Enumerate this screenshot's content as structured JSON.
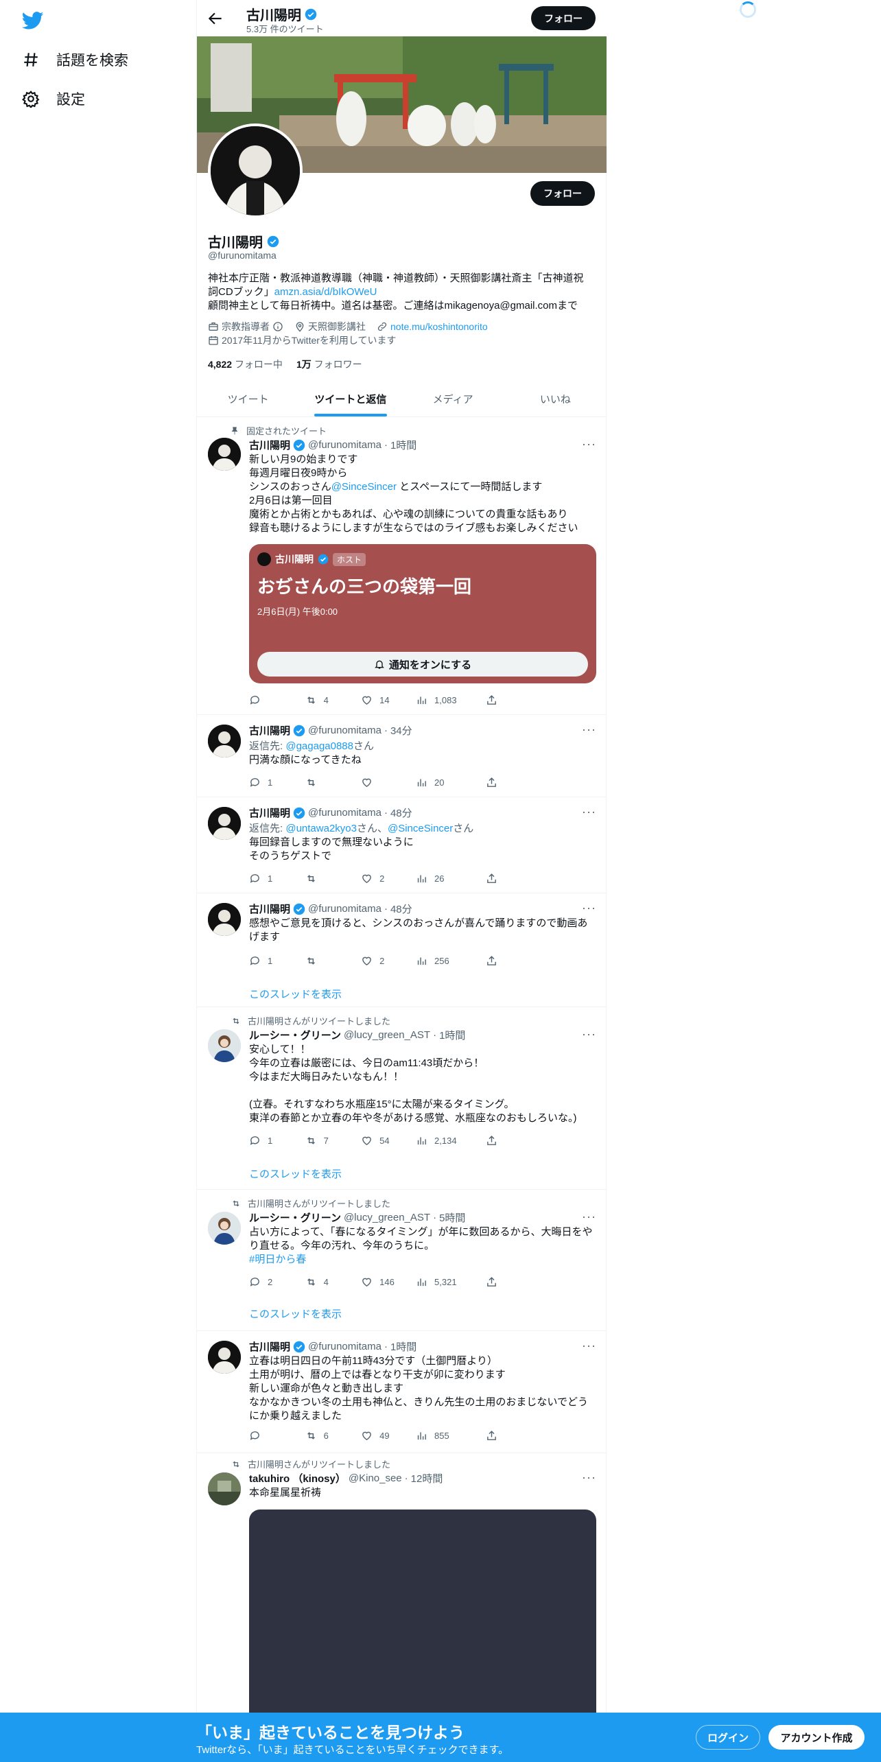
{
  "sidebar": {
    "items": [
      {
        "label": "話題を検索"
      },
      {
        "label": "設定"
      }
    ]
  },
  "header": {
    "name": "古川陽明",
    "tweet_count": "5.3万 件のツイート",
    "follow_label": "フォロー"
  },
  "profile": {
    "name": "古川陽明",
    "handle": "@furunomitama",
    "bio_line1": "神社本庁正階・教派神道教導職（神職・神道教師）・天照御影講社斎主「古神道祝詞CDブック」",
    "bio_link": "amzn.asia/d/bIkOWeU",
    "bio_line2": "顧問神主として毎日祈祷中。道名は基密。ご連絡はmikagenoya@gmail.comまで",
    "category": "宗教指導者",
    "location": "天照御影講社",
    "website": "note.mu/koshintonorito",
    "joined": "2017年11月からTwitterを利用しています",
    "following_count": "4,822",
    "following_label": "フォロー中",
    "followers_count": "1万",
    "followers_label": "フォロワー",
    "follow_label": "フォロー"
  },
  "tabs": [
    "ツイート",
    "ツイートと返信",
    "メディア",
    "いいね"
  ],
  "tweets": [
    {
      "context": "固定されたツイート",
      "name": "古川陽明",
      "handle": "@furunomitama",
      "time": "1時間",
      "body_a": "新しい月9の始まりです\n毎週月曜日夜9時から\nシンスのおっさん",
      "mention": "@SinceSincer",
      "body_b": " とスペースにて一時間話します\n2月6日は第一回目\n魔術とか占術とかもあれば、心や魂の訓練についての貴重な話もあり\n録音も聴けるようにしますが生ならではのライブ感もお楽しみください",
      "space": {
        "host": "古川陽明",
        "badge": "ホスト",
        "title": "おぢさんの三つの袋第一回",
        "date": "2月6日(月) 午後0:00",
        "button": "通知をオンにする"
      },
      "replies": "",
      "retweets": "4",
      "likes": "14",
      "views": "1,083"
    },
    {
      "name": "古川陽明",
      "handle": "@furunomitama",
      "time": "34分",
      "reply_prefix": "返信先: ",
      "reply_to": "@gagaga0888",
      "reply_suffix": "さん",
      "body": "円満な顔になってきたね",
      "replies": "1",
      "retweets": "",
      "likes": "",
      "views": "20"
    },
    {
      "name": "古川陽明",
      "handle": "@furunomitama",
      "time": "48分",
      "reply_prefix": "返信先: ",
      "reply_to": "@untawa2kyo3",
      "reply_mid": "さん、",
      "reply_to2": "@SinceSincer",
      "reply_suffix": "さん",
      "body": "毎回録音しますので無理ないように\nそのうちゲストで",
      "replies": "1",
      "retweets": "",
      "likes": "2",
      "views": "26"
    },
    {
      "name": "古川陽明",
      "handle": "@furunomitama",
      "time": "48分",
      "body": "感想やご意見を頂けると、シンスのおっさんが喜んで踊りますので動画あげます",
      "replies": "1",
      "retweets": "",
      "likes": "2",
      "views": "256",
      "thread": "このスレッドを表示"
    },
    {
      "context": "古川陽明さんがリツイートしました",
      "name": "ルーシー・グリーン",
      "handle": "@lucy_green_AST",
      "time": "1時間",
      "body": "安心して！！\n今年の立春は厳密には、今日のam11:43頃だから！\n今はまだ大晦日みたいなもん！！\n\n(立春。それすなわち水瓶座15°に太陽が来るタイミング。\n東洋の春節とか立春の年や冬があける感覚、水瓶座なのおもしろいな。)",
      "replies": "1",
      "retweets": "7",
      "likes": "54",
      "views": "2,134",
      "thread": "このスレッドを表示"
    },
    {
      "context": "古川陽明さんがリツイートしました",
      "name": "ルーシー・グリーン",
      "handle": "@lucy_green_AST",
      "time": "5時間",
      "body": "占い方によって、「春になるタイミング」が年に数回あるから、大晦日をやり直せる。今年の汚れ、今年のうちに。",
      "hashtag": "#明日から春",
      "replies": "2",
      "retweets": "4",
      "likes": "146",
      "views": "5,321",
      "thread": "このスレッドを表示"
    },
    {
      "name": "古川陽明",
      "handle": "@furunomitama",
      "time": "1時間",
      "body": "立春は明日四日の午前11時43分です（土御門暦より）\n土用が明け、暦の上では春となり干支が卯に変わります\n新しい運命が色々と動き出します\nなかなかきつい冬の土用も神仏と、きりん先生の土用のおまじないでどうにか乗り越えました",
      "replies": "",
      "retweets": "6",
      "likes": "49",
      "views": "855"
    },
    {
      "context": "古川陽明さんがリツイートしました",
      "name": "takuhiro （kinosy）",
      "handle": "@Kino_see",
      "time": "12時間",
      "body": "本命星属星祈祷"
    }
  ],
  "bottom": {
    "title": "「いま」起きていることを見つけよう",
    "subtitle": "Twitterなら、「いま」起きていることをいち早くチェックできます。",
    "login": "ログイン",
    "signup": "アカウント作成"
  },
  "colors": {
    "accent": "#1d9bf0",
    "space_card": "#a5504f",
    "text": "#0f1419",
    "muted": "#536471"
  }
}
